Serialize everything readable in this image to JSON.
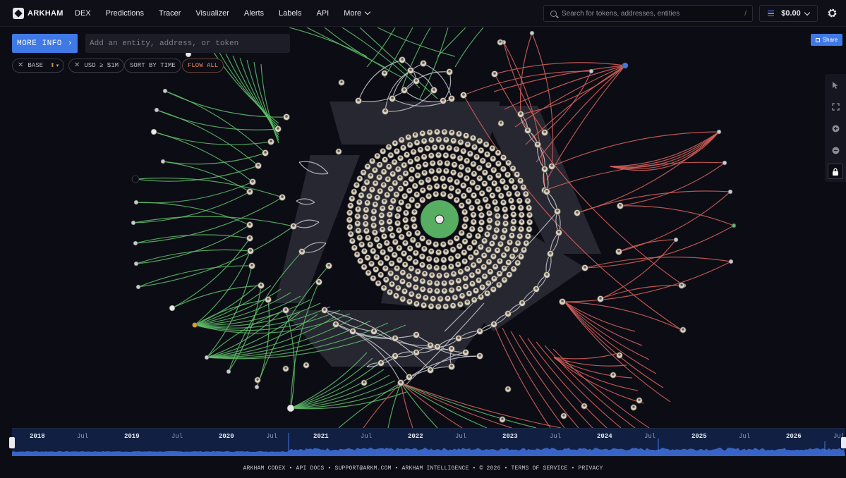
{
  "app": {
    "brand": "ARKHAM"
  },
  "nav": {
    "items": [
      "DEX",
      "Predictions",
      "Tracer",
      "Visualizer",
      "Alerts",
      "Labels",
      "API"
    ],
    "more_label": "More"
  },
  "search": {
    "placeholder": "Search for tokens, addresses, entities",
    "shortcut": "/"
  },
  "wallet": {
    "balance": "$0.00"
  },
  "toolbar": {
    "more_info_label": "MORE INFO",
    "entity_placeholder": "Add an entity, address, or token",
    "share_label": "Share"
  },
  "filters": {
    "chain_label": "BASE",
    "usd_label": "USD ≥ $1M",
    "sort_label": "SORT BY TIME",
    "flow_label": "FLOW ALL"
  },
  "tools": [
    "pointer-icon",
    "fit-screen-icon",
    "zoom-in-icon",
    "zoom-out-icon",
    "lock-icon"
  ],
  "timeline": {
    "labels": [
      "2018",
      "Jul",
      "2019",
      "Jul",
      "2020",
      "Jul",
      "2021",
      "Jul",
      "2022",
      "Jul",
      "2023",
      "Jul",
      "2024",
      "Jul",
      "2025",
      "Jul",
      "2026",
      "Jul"
    ]
  },
  "footer": {
    "text": "ARKHAM CODEX • API DOCS • SUPPORT@ARKM.COM • ARKHAM INTELLIGENCE • © 2026 • TERMS OF SERVICE • PRIVACY"
  },
  "colors": {
    "accent": "#3f79e6",
    "inflow": "#5fbf6a",
    "outflow": "#d9625a",
    "neutral_edge": "#c8c8d0",
    "background": "#0b0c14"
  }
}
